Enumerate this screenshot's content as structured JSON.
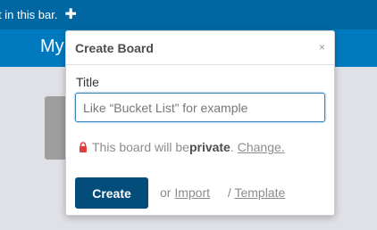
{
  "topbar": {
    "hint_text": "t in this bar.",
    "plus_glyph": "✚"
  },
  "board": {
    "title": "My"
  },
  "popover": {
    "title": "Create Board",
    "close_glyph": "×",
    "field_label": "Title",
    "input_value": "",
    "input_placeholder": "Like “Bucket List” for example",
    "privacy_prefix": "This board will be ",
    "privacy_level": "private",
    "privacy_period": ".",
    "change_link": "Change.",
    "create_button": "Create",
    "or_text": "or",
    "import_link": "Import",
    "slash_text": "/",
    "template_link": "Template"
  },
  "colors": {
    "topbar": "#0067a3",
    "boardbar": "#0079bf",
    "create_button": "#024d7a",
    "lock": "#e03c3c"
  },
  "icons": {
    "plus": "plus-icon",
    "close": "close-icon",
    "lock": "lock-icon"
  }
}
